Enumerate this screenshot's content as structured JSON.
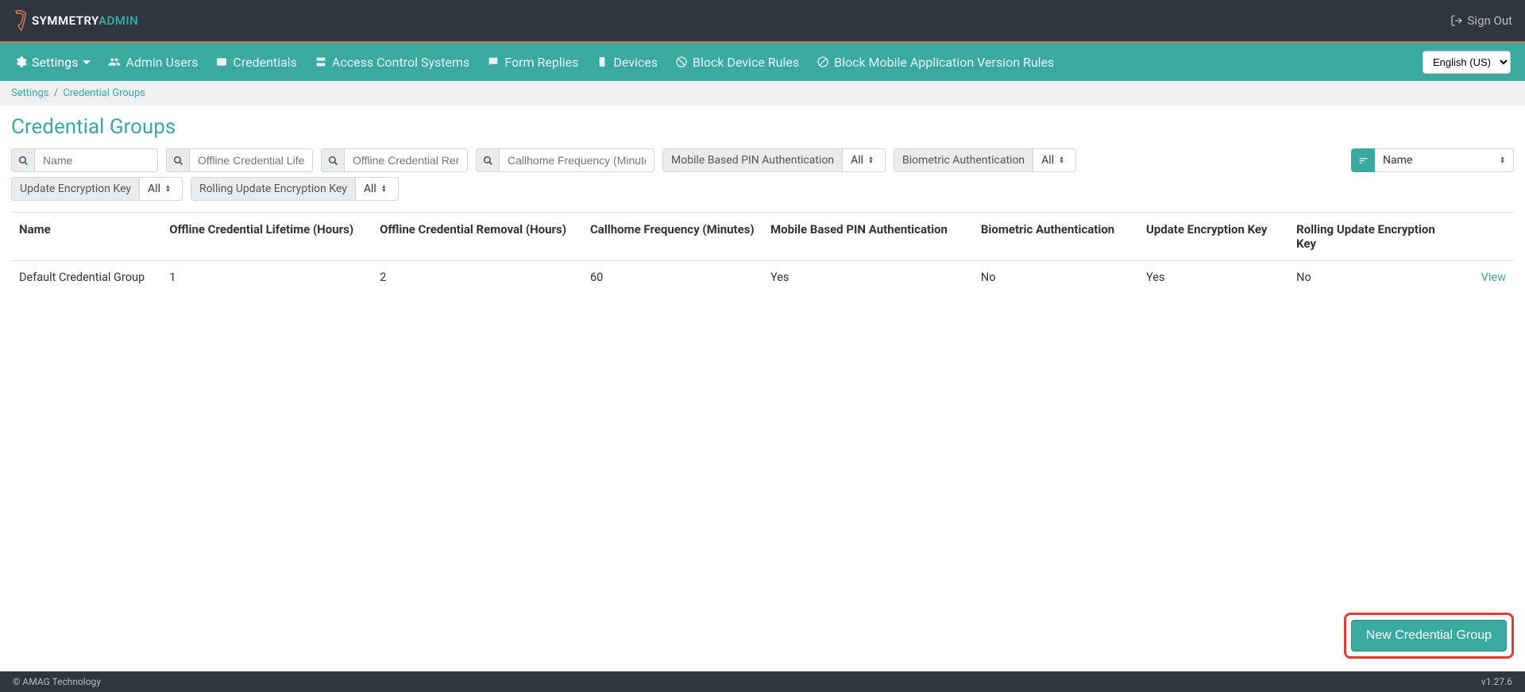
{
  "header": {
    "brand_a": "SYMMETRY",
    "brand_b": "ADMIN",
    "signout": "Sign Out"
  },
  "nav": {
    "settings": "Settings",
    "admin_users": "Admin Users",
    "credentials": "Credentials",
    "access_control": "Access Control Systems",
    "form_replies": "Form Replies",
    "devices": "Devices",
    "block_device_rules": "Block Device Rules",
    "block_mobile_rules": "Block Mobile Application Version Rules",
    "language": "English (US)"
  },
  "breadcrumb": {
    "settings": "Settings",
    "current": "Credential Groups"
  },
  "page": {
    "title": "Credential Groups"
  },
  "filters": {
    "name_ph": "Name",
    "offline_lifetime_ph": "Offline Credential Lifetime (Hours)",
    "offline_removal_ph": "Offline Credential Removal (Hours)",
    "callhome_ph": "Callhome Frequency (Minutes)",
    "mobile_pin_label": "Mobile Based PIN Authentication",
    "biometric_label": "Biometric Authentication",
    "update_key_label": "Update Encryption Key",
    "rolling_key_label": "Rolling Update Encryption Key",
    "all": "All",
    "sort_value": "Name"
  },
  "table": {
    "headers": {
      "name": "Name",
      "offline_lifetime": "Offline Credential Lifetime (Hours)",
      "offline_removal": "Offline Credential Removal (Hours)",
      "callhome": "Callhome Frequency (Minutes)",
      "mobile_pin": "Mobile Based PIN Authentication",
      "biometric": "Biometric Authentication",
      "update_key": "Update Encryption Key",
      "rolling_key": "Rolling Update Encryption Key"
    },
    "row": {
      "name": "Default Credential Group",
      "offline_lifetime": "1",
      "offline_removal": "2",
      "callhome": "60",
      "mobile_pin": "Yes",
      "biometric": "No",
      "update_key": "Yes",
      "rolling_key": "No",
      "view": "View"
    }
  },
  "actions": {
    "new_group": "New Credential Group"
  },
  "footer": {
    "copyright": "© AMAG Technology",
    "version": "v1.27.6"
  }
}
